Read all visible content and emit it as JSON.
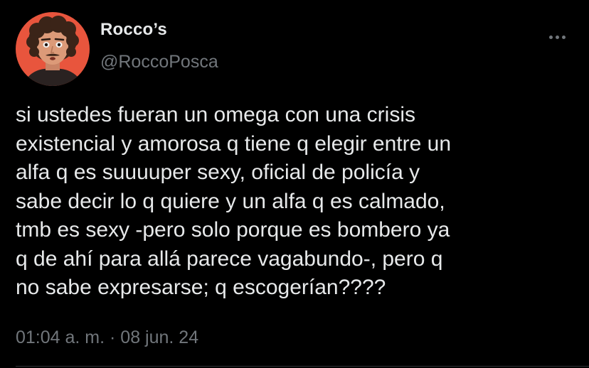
{
  "author": {
    "display_name": "Rocco’s",
    "handle": "@RoccoPosca",
    "avatar_icon": "profile-photo"
  },
  "tweet": {
    "text": "si ustedes fueran un omega con una crisis\nexistencial y amorosa q tiene q elegir entre un\nalfa q es suuuuper sexy, oficial de policía y\nsabe decir lo q quiere y un alfa q es calmado,\ntmb es sexy -pero solo porque es bombero ya\nq de ahí para allá parece vagabundo-, pero q\nno sabe expresarse; q escogerían????",
    "timestamp": "01:04 a. m. · 08 jun. 24"
  },
  "menu": {
    "icon": "more-horizontal-icon"
  },
  "colors": {
    "background": "#000000",
    "primary_text": "#e7e9ea",
    "secondary_text": "#71767b",
    "avatar_bg": "#e8553d",
    "divider": "#2f3336"
  }
}
